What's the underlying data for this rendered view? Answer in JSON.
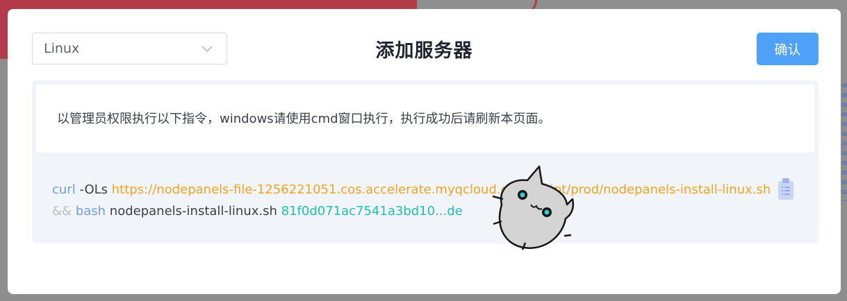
{
  "os_select": {
    "value": "Linux"
  },
  "dialog": {
    "title": "添加服务器",
    "confirm_label": "确认"
  },
  "instruction": "以管理员权限执行以下指令，windows请使用cmd窗口执行，执行成功后请刷新本页面。",
  "command": {
    "cmd": "curl",
    "flags": "-OLs",
    "url": "https://nodepanels-file-1256221051.cos.accelerate.myqcloud.com/script/prod/nodepanels-install-linux.sh",
    "and": "&&",
    "bash": "bash",
    "script": "nodepanels-install-linux.sh",
    "token": "81f0d071ac7541a3bd10...de"
  },
  "icons": {
    "select": "chevron-down-icon",
    "copy": "clipboard-icon",
    "mascot": "cat-mascot"
  }
}
